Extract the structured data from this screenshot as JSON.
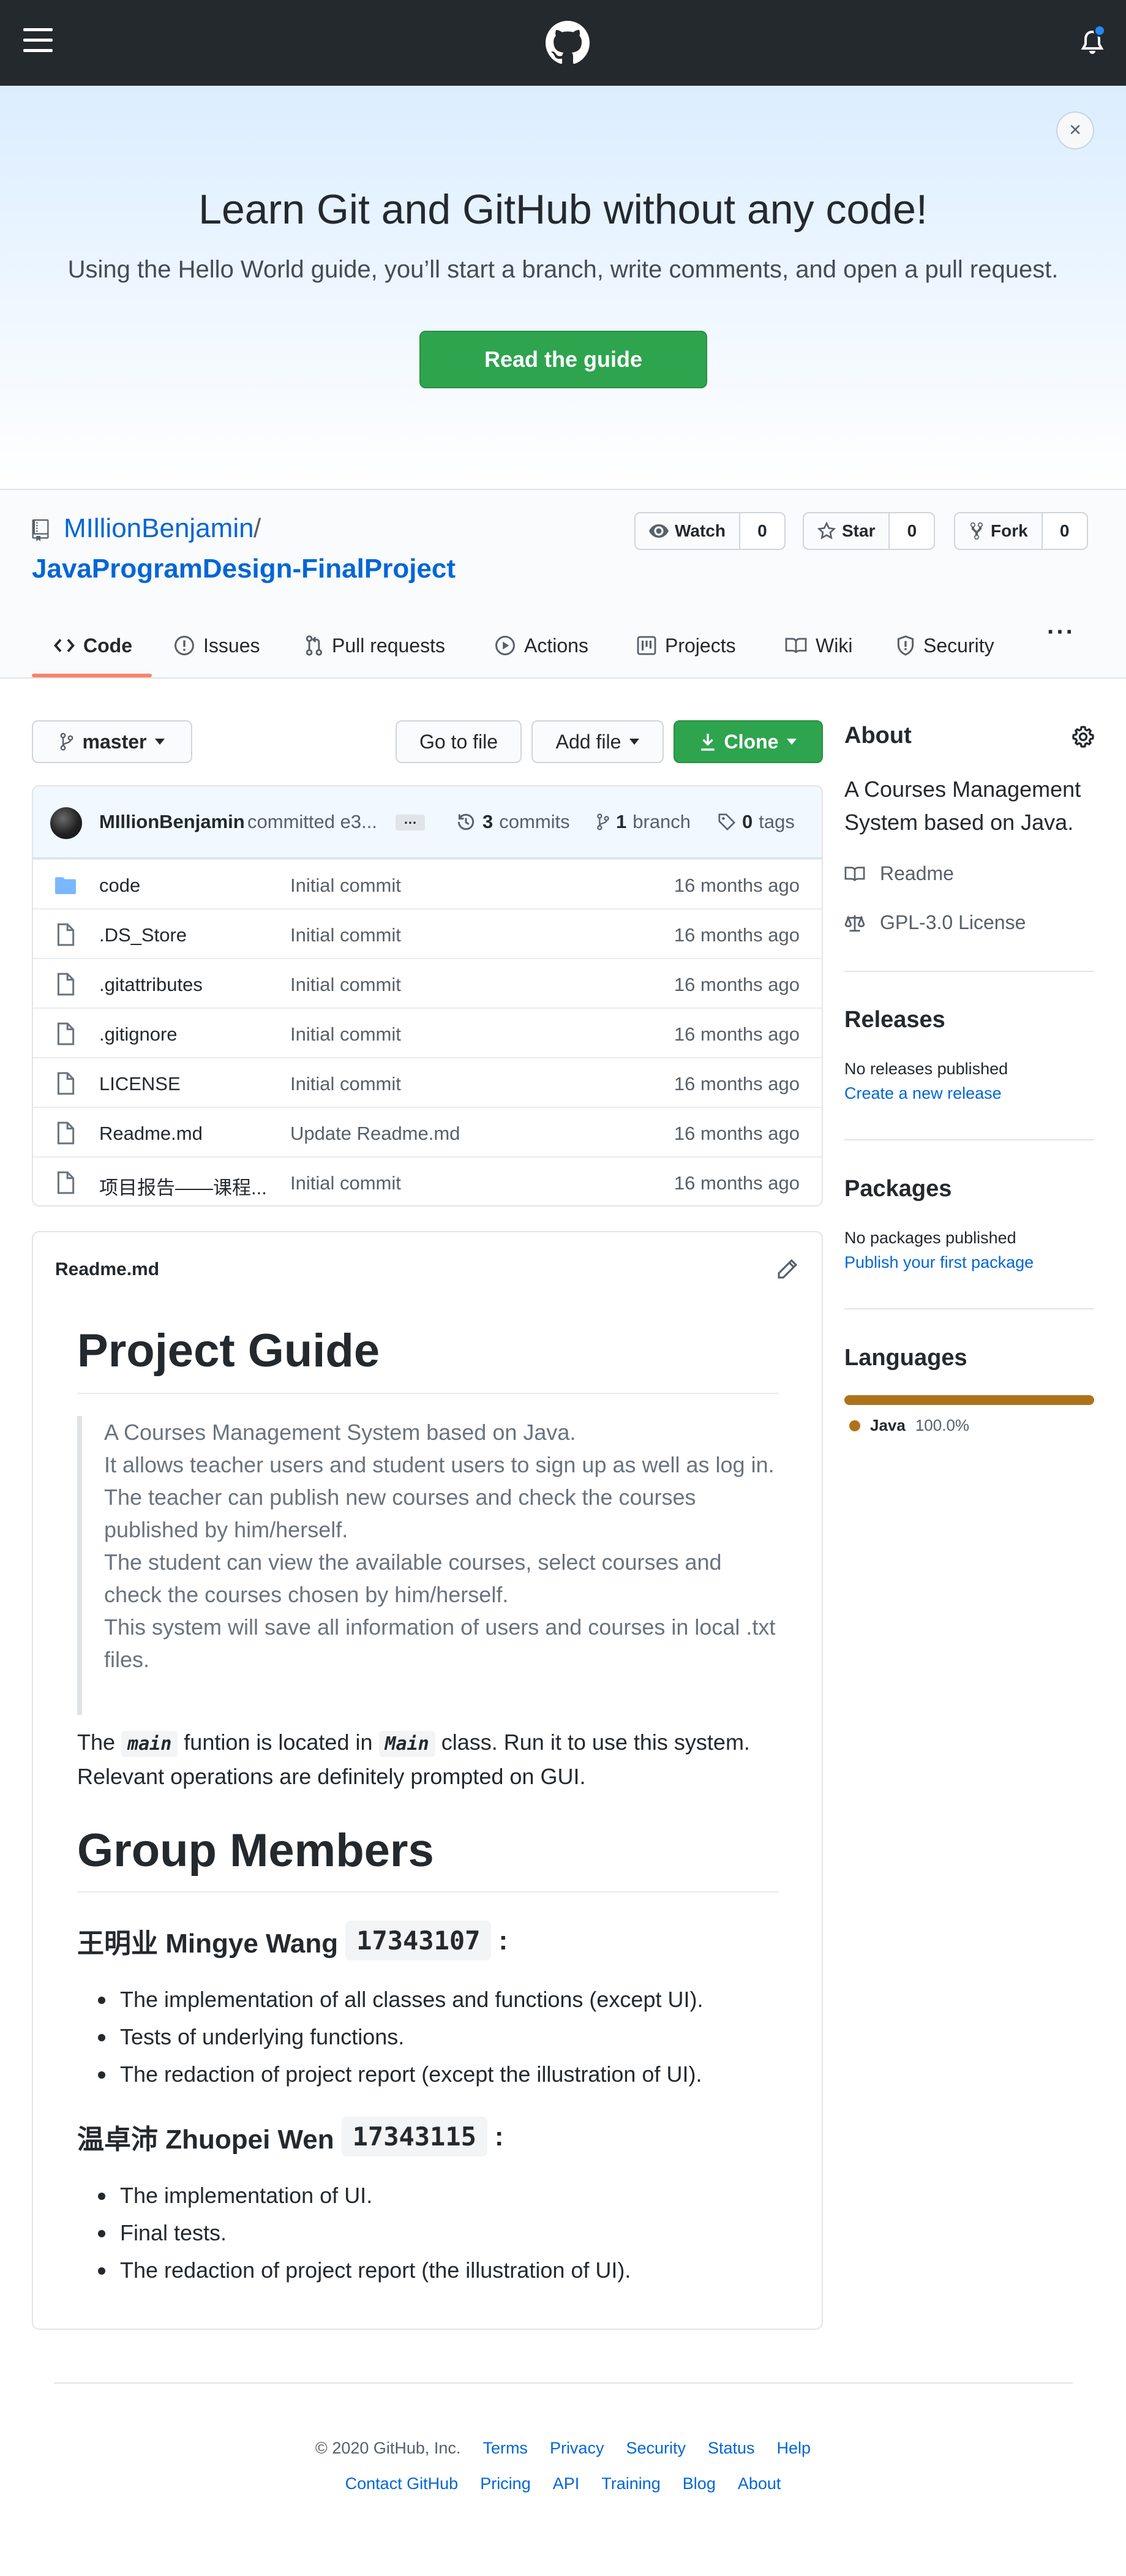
{
  "banner": {
    "title": "Learn Git and GitHub without any code!",
    "subtitle": "Using the Hello World guide, you’ll start a branch, write comments, and open a pull request.",
    "button": "Read the guide",
    "close": "×"
  },
  "repo": {
    "owner": "MIllionBenjamin",
    "slash": "/",
    "name": "JavaProgramDesign-FinalProject",
    "watch": {
      "label": "Watch",
      "count": "0"
    },
    "star": {
      "label": "Star",
      "count": "0"
    },
    "fork": {
      "label": "Fork",
      "count": "0"
    }
  },
  "tabs": [
    {
      "label": "Code",
      "icon": "code-icon"
    },
    {
      "label": "Issues",
      "icon": "issue-icon"
    },
    {
      "label": "Pull requests",
      "icon": "pull-request-icon"
    },
    {
      "label": "Actions",
      "icon": "play-icon"
    },
    {
      "label": "Projects",
      "icon": "project-icon"
    },
    {
      "label": "Wiki",
      "icon": "book-icon"
    },
    {
      "label": "Security",
      "icon": "shield-icon"
    }
  ],
  "more": "···",
  "toolbar": {
    "branch": "master",
    "go_to_file": "Go to file",
    "add_file": "Add file",
    "clone": "Clone"
  },
  "commit": {
    "author": "MIllionBenjamin",
    "message": "committed e3...",
    "ellipsis": "…",
    "commits_count": "3",
    "commits_label": "commits",
    "branch_count": "1",
    "branch_label": "branch",
    "tags_count": "0",
    "tags_label": "tags"
  },
  "files": [
    {
      "name": "code",
      "message": "Initial commit",
      "age": "16 months ago",
      "type": "folder"
    },
    {
      "name": ".DS_Store",
      "message": "Initial commit",
      "age": "16 months ago",
      "type": "file"
    },
    {
      "name": ".gitattributes",
      "message": "Initial commit",
      "age": "16 months ago",
      "type": "file"
    },
    {
      "name": ".gitignore",
      "message": "Initial commit",
      "age": "16 months ago",
      "type": "file"
    },
    {
      "name": "LICENSE",
      "message": "Initial commit",
      "age": "16 months ago",
      "type": "file"
    },
    {
      "name": "Readme.md",
      "message": "Update Readme.md",
      "age": "16 months ago",
      "type": "file"
    },
    {
      "name": "项目报告——课程...",
      "message": "Initial commit",
      "age": "16 months ago",
      "type": "file"
    }
  ],
  "readme": {
    "filename": "Readme.md",
    "h1": "Project Guide",
    "quote": [
      "A Courses Management System based on Java.",
      "It allows teacher users and student users to sign up as well as log in.",
      "The teacher can publish new courses and check the courses published by him/herself.",
      "The student can view the available courses, select courses and check the courses chosen by him/herself.",
      "This system will save all information of users and courses in local .txt files."
    ],
    "para": {
      "p1": "The ",
      "code1": "main",
      "p2": " funtion is located in ",
      "code2": "Main",
      "p3": " class. Run it to use this system. Relevant operations are definitely prompted on GUI."
    },
    "h2": "Group Members",
    "member1": {
      "name": "王明业 Mingye Wang",
      "id": "17343107",
      "colon": ":"
    },
    "member1_items": [
      "The implementation of all classes and functions (except UI).",
      "Tests of underlying functions.",
      "The redaction of project report (except the illustration of UI)."
    ],
    "member2": {
      "name": "温卓沛 Zhuopei Wen",
      "id": "17343115",
      "colon": ":"
    },
    "member2_items": [
      "The implementation of UI.",
      "Final tests.",
      "The redaction of project report (the illustration of UI)."
    ]
  },
  "sidebar": {
    "about_title": "About",
    "description": "A Courses Management System based on Java.",
    "readme_link": "Readme",
    "license_link": "GPL-3.0 License",
    "releases_title": "Releases",
    "releases_text": "No releases published",
    "releases_link": "Create a new release",
    "packages_title": "Packages",
    "packages_text": "No packages published",
    "packages_link": "Publish your first package",
    "languages_title": "Languages",
    "language": {
      "name": "Java",
      "percent": "100.0%",
      "share": 1.0,
      "color": "#b07219"
    }
  },
  "footer": {
    "copyright": "© 2020 GitHub, Inc.",
    "row1": [
      "Terms",
      "Privacy",
      "Security",
      "Status",
      "Help"
    ],
    "row2": [
      "Contact GitHub",
      "Pricing",
      "API",
      "Training",
      "Blog",
      "About"
    ]
  },
  "colors": {
    "accent": "#0366d6",
    "green": "#2ea44f",
    "tab_underline": "#f9826c",
    "header": "#24292e"
  }
}
